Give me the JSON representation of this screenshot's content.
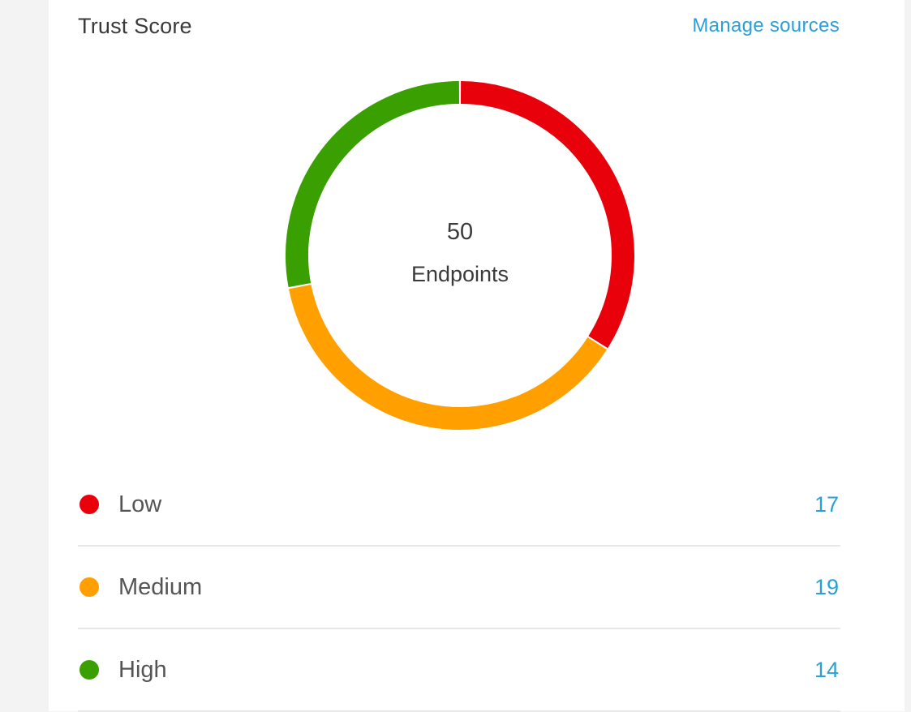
{
  "header": {
    "title": "Trust Score",
    "manage_link": "Manage sources"
  },
  "donut": {
    "total": "50",
    "total_label": "Endpoints"
  },
  "chart_data": {
    "type": "pie",
    "categories": [
      "Low",
      "Medium",
      "High"
    ],
    "values": [
      17,
      19,
      14
    ],
    "colors": [
      "#e8000b",
      "#ffa000",
      "#3a9f00"
    ]
  },
  "legend": [
    {
      "label": "Low",
      "value": "17",
      "color": "#e8000b"
    },
    {
      "label": "Medium",
      "value": "19",
      "color": "#ffa000"
    },
    {
      "label": "High",
      "value": "14",
      "color": "#3a9f00"
    }
  ]
}
